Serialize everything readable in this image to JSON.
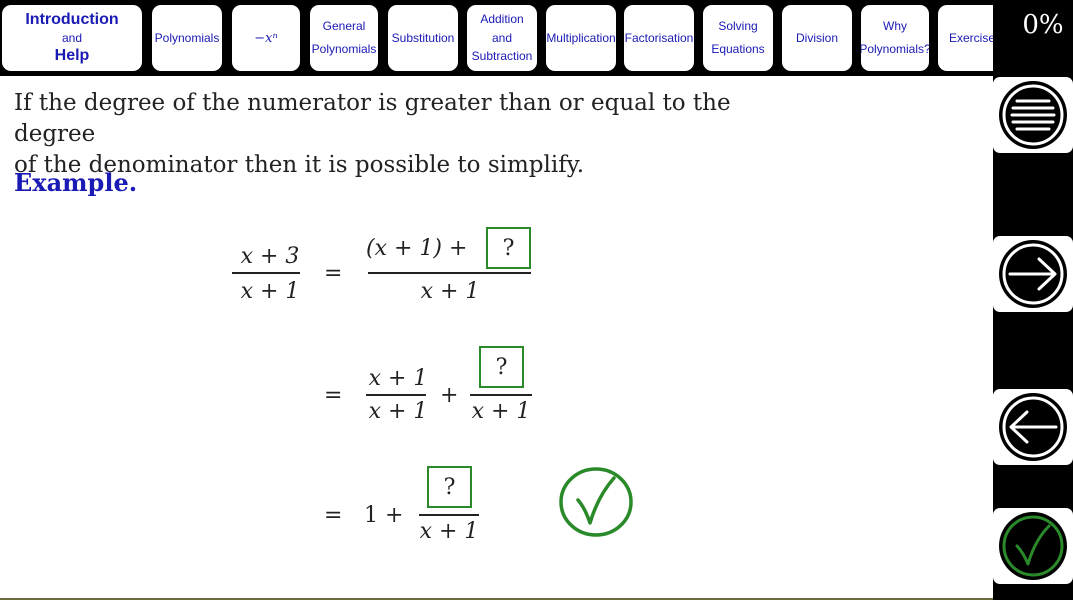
{
  "nav": {
    "tabs": [
      {
        "lines": [
          "Introduction",
          "and",
          "Help"
        ]
      },
      {
        "lines": [
          "Polynomials"
        ]
      },
      {
        "lines": [
          "−xⁿ"
        ]
      },
      {
        "lines": [
          "General",
          "Polynomials"
        ]
      },
      {
        "lines": [
          "Substitution"
        ]
      },
      {
        "lines": [
          "Addition",
          "and",
          "Subtraction"
        ]
      },
      {
        "lines": [
          "Multiplication"
        ]
      },
      {
        "lines": [
          "Factorisation"
        ]
      },
      {
        "lines": [
          "Solving",
          "Equations"
        ]
      },
      {
        "lines": [
          "Division"
        ]
      },
      {
        "lines": [
          "Why",
          "Polynomials?"
        ]
      },
      {
        "lines": [
          "Exercises"
        ]
      }
    ]
  },
  "progress": "0%",
  "content": {
    "intro_line1": "If the degree of the numerator is greater than or equal to the degree",
    "intro_line2": "of the denominator then it is possible to simplify.",
    "example_label": "Example.",
    "lhs_num": "x + 3",
    "lhs_den": "x + 1",
    "eq": "=",
    "plus": "+",
    "step1_num": "(x + 1) +",
    "step1_den": "x + 1",
    "step2_num": "x + 1",
    "step2_den": "x + 1",
    "step2_den2": "x + 1",
    "step3_one": "1 +",
    "step3_den": "x + 1",
    "placeholder": "?"
  },
  "colors": {
    "accent_blue": "#1a1ab4",
    "check_green": "#2a8a2a",
    "panel_black": "#000000"
  },
  "icons": {
    "menu": "menu-icon",
    "next": "arrow-right-icon",
    "back": "arrow-left-icon",
    "check": "check-icon"
  }
}
